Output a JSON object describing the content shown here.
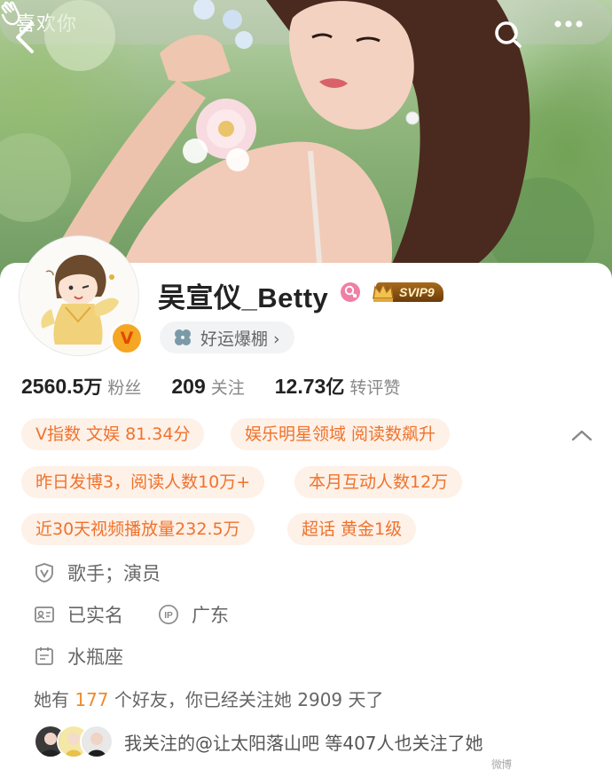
{
  "header": {
    "like_label": "喜欢你"
  },
  "profile": {
    "name": "吴宣仪_Betty",
    "vip_label": "SVIP9",
    "verified_badge": "V",
    "luck_label": "好运爆棚 ›"
  },
  "stats": [
    {
      "value": "2560.5",
      "unit": "万",
      "label": "粉丝"
    },
    {
      "value": "209",
      "unit": "",
      "label": "关注"
    },
    {
      "value": "12.73",
      "unit": "亿",
      "label": "转评赞"
    }
  ],
  "tags": [
    "V指数 文娱 81.34分",
    "娱乐明星领域 阅读数飙升",
    "昨日发博3，阅读人数10万+",
    "本月互动人数12万",
    "近30天视频播放量232.5万",
    "超话 黄金1级"
  ],
  "info": {
    "occupation": "歌手；演员",
    "real_name": "已实名",
    "ip_location": "广东",
    "zodiac": "水瓶座"
  },
  "friends": {
    "prefix": "她有 ",
    "count": "177",
    "suffix": " 个好友，你已经关注她 2909 天了"
  },
  "mutual": {
    "text": "我关注的@让太阳落山吧  等407人也关注了她"
  },
  "watermark": "微博",
  "colors": {
    "accent_orange": "#f0722c",
    "tag_bg": "#fdf1e8",
    "highlight": "#f08a2c",
    "vip_gold": "#a86b1d"
  },
  "icons": {
    "back": "back-arrow-icon",
    "like": "clap-hands-icon",
    "search": "search-icon",
    "more": "more-dots-icon",
    "gender": "female-icon",
    "luck": "clover-icon",
    "collapse": "chevron-up-icon",
    "occupation": "shield-v-icon",
    "real_name": "id-card-icon",
    "ip": "ip-icon",
    "zodiac": "calendar-icon"
  }
}
